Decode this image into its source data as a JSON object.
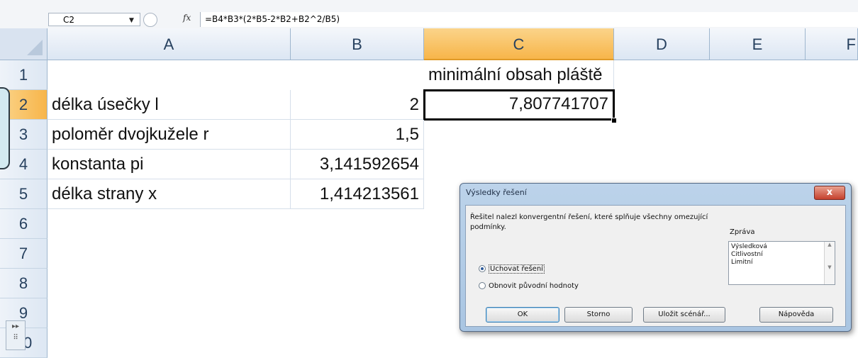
{
  "formula_bar": {
    "name_box": "C2",
    "fx_label": "fx",
    "formula": "=B4*B3*(2*B5-2*B2+B2^2/B5)"
  },
  "columns": [
    "A",
    "B",
    "C",
    "D",
    "E",
    "F"
  ],
  "rows": [
    "1",
    "2",
    "3",
    "4",
    "5",
    "6",
    "7",
    "8",
    "9",
    "10"
  ],
  "cells": {
    "C1": "minimální obsah pláště",
    "A2": "délka úsečky l",
    "B2": "2",
    "C2": "7,807741707",
    "A3": "poloměr dvojkužele r",
    "B3": "1,5",
    "A4": "konstanta pi",
    "B4": "3,141592654",
    "A5": "délka strany x",
    "B5": "1,414213561"
  },
  "dialog": {
    "title": "Výsledky řešení",
    "close_label": "x",
    "message": "Řešitel nalezl konvergentní řešení, které splňuje všechny omezující podmínky.",
    "report_label": "Zpráva",
    "reports": [
      "Výsledková",
      "Citlivostní",
      "Limitní"
    ],
    "radio_keep": "Uchovat řešení",
    "radio_restore": "Obnovit původní hodnoty",
    "buttons": {
      "ok": "OK",
      "cancel": "Storno",
      "save_scenario": "Uložit scénář...",
      "help": "Nápověda"
    }
  }
}
